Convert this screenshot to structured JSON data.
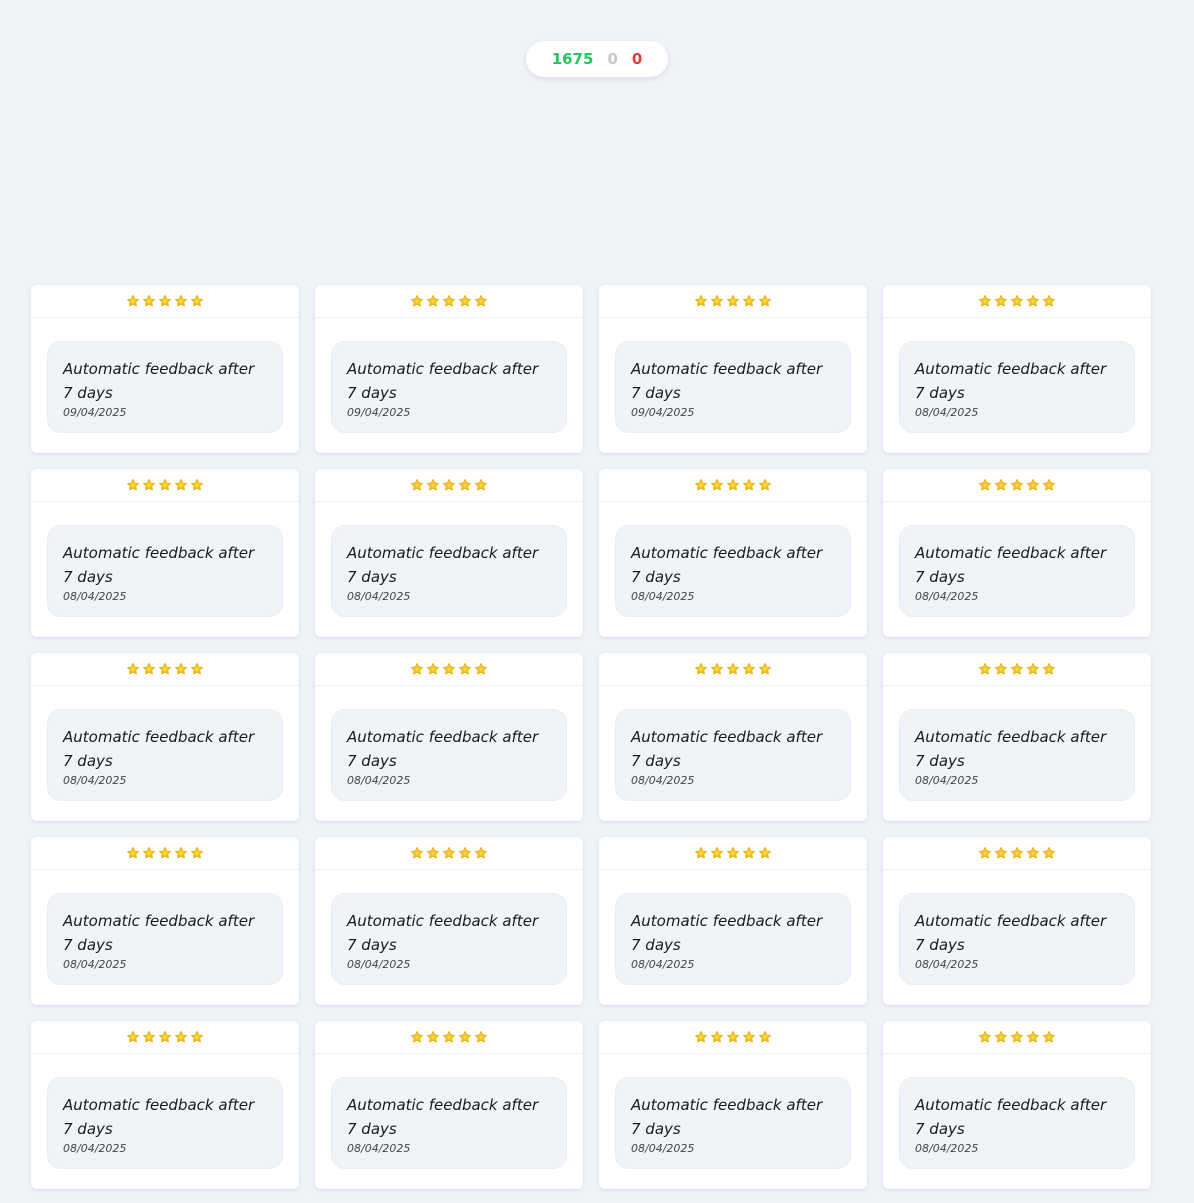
{
  "counters": {
    "positive": "1675",
    "neutral": "0",
    "negative": "0"
  },
  "colors": {
    "positive": "#22c55e",
    "neutral": "#c8c8c8",
    "negative": "#e53935",
    "star": "#f5c518"
  },
  "cards": [
    {
      "rating": 5,
      "text": "Automatic feedback after 7 days",
      "date": "09/04/2025"
    },
    {
      "rating": 5,
      "text": "Automatic feedback after 7 days",
      "date": "09/04/2025"
    },
    {
      "rating": 5,
      "text": "Automatic feedback after 7 days",
      "date": "09/04/2025"
    },
    {
      "rating": 5,
      "text": "Automatic feedback after 7 days",
      "date": "08/04/2025"
    },
    {
      "rating": 5,
      "text": "Automatic feedback after 7 days",
      "date": "08/04/2025"
    },
    {
      "rating": 5,
      "text": "Automatic feedback after 7 days",
      "date": "08/04/2025"
    },
    {
      "rating": 5,
      "text": "Automatic feedback after 7 days",
      "date": "08/04/2025"
    },
    {
      "rating": 5,
      "text": "Automatic feedback after 7 days",
      "date": "08/04/2025"
    },
    {
      "rating": 5,
      "text": "Automatic feedback after 7 days",
      "date": "08/04/2025"
    },
    {
      "rating": 5,
      "text": "Automatic feedback after 7 days",
      "date": "08/04/2025"
    },
    {
      "rating": 5,
      "text": "Automatic feedback after 7 days",
      "date": "08/04/2025"
    },
    {
      "rating": 5,
      "text": "Automatic feedback after 7 days",
      "date": "08/04/2025"
    },
    {
      "rating": 5,
      "text": "Automatic feedback after 7 days",
      "date": "08/04/2025"
    },
    {
      "rating": 5,
      "text": "Automatic feedback after 7 days",
      "date": "08/04/2025"
    },
    {
      "rating": 5,
      "text": "Automatic feedback after 7 days",
      "date": "08/04/2025"
    },
    {
      "rating": 5,
      "text": "Automatic feedback after 7 days",
      "date": "08/04/2025"
    },
    {
      "rating": 5,
      "text": "Automatic feedback after 7 days",
      "date": "08/04/2025"
    },
    {
      "rating": 5,
      "text": "Automatic feedback after 7 days",
      "date": "08/04/2025"
    },
    {
      "rating": 5,
      "text": "Automatic feedback after 7 days",
      "date": "08/04/2025"
    },
    {
      "rating": 5,
      "text": "Automatic feedback after 7 days",
      "date": "08/04/2025"
    }
  ],
  "icons": {
    "star": "star-icon"
  }
}
